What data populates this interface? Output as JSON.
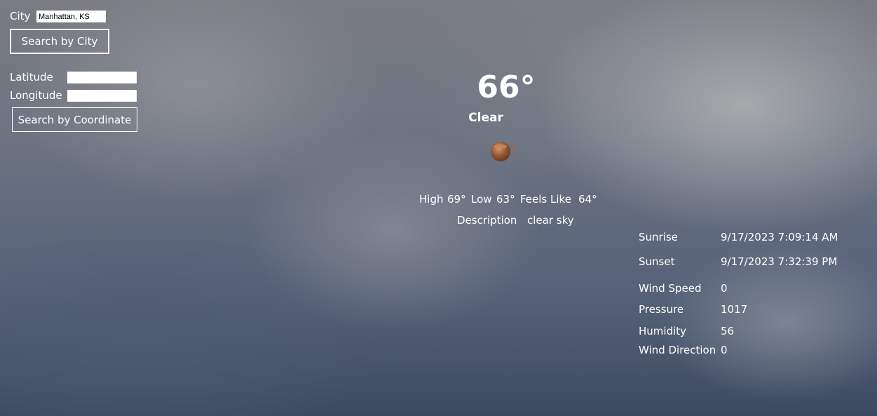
{
  "search": {
    "city_label": "City",
    "city_value": "Manhattan, KS",
    "city_button": "Search by City",
    "latitude_label": "Latitude",
    "latitude_value": "",
    "longitude_label": "Longitude",
    "longitude_value": "",
    "coord_button": "Search by Coordinate"
  },
  "current": {
    "temperature": "66°",
    "condition": "Clear",
    "icon": "clear-weather-icon",
    "high_label": "High",
    "high_value": "69°",
    "low_label": "Low",
    "low_value": "63°",
    "feels_label": "Feels Like",
    "feels_value": "64°",
    "description_label": "Description",
    "description_value": "clear sky"
  },
  "details": [
    {
      "label": "Sunrise",
      "value": "9/17/2023 7:09:14 AM"
    },
    {
      "label": "Sunset",
      "value": "9/17/2023 7:32:39 PM"
    },
    {
      "label": "Wind Speed",
      "value": "0"
    },
    {
      "label": "Pressure",
      "value": "1017"
    },
    {
      "label": "Humidity",
      "value": "56"
    },
    {
      "label": "Wind Direction",
      "value": "0"
    }
  ],
  "colors": {
    "text": "#ffffff",
    "icon_main": "#9a5a36",
    "icon_highlight": "#c98a62"
  }
}
